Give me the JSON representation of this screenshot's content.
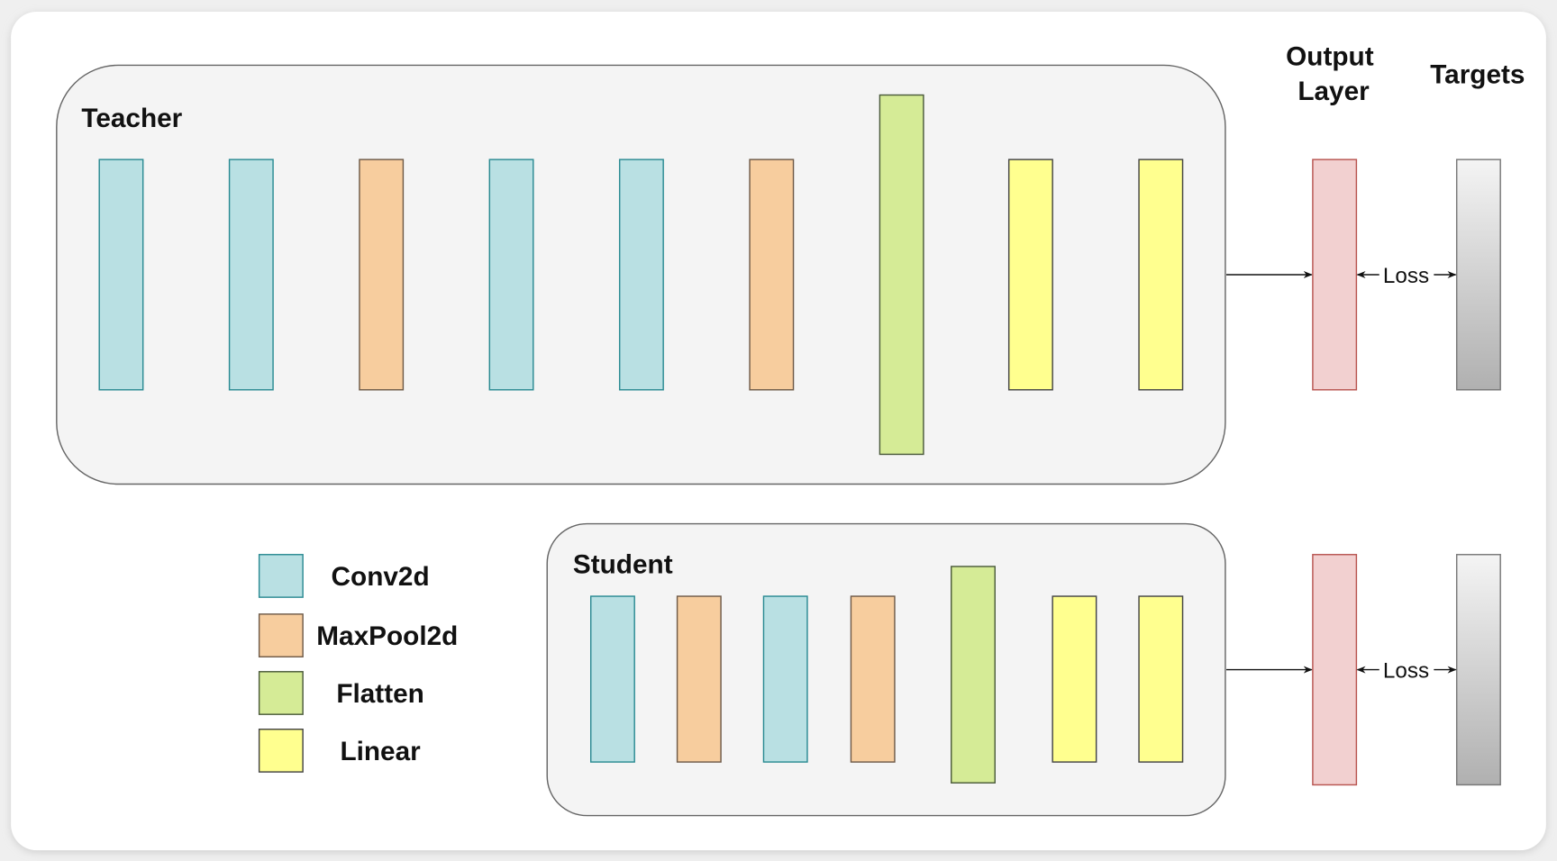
{
  "teacher": {
    "label": "Teacher",
    "layers": [
      "Conv2d",
      "Conv2d",
      "MaxPool2d",
      "Conv2d",
      "Conv2d",
      "MaxPool2d",
      "Flatten",
      "Linear",
      "Linear"
    ]
  },
  "student": {
    "label": "Student",
    "layers": [
      "Conv2d",
      "MaxPool2d",
      "Conv2d",
      "MaxPool2d",
      "Flatten",
      "Linear",
      "Linear"
    ]
  },
  "headers": {
    "output_line1": "Output",
    "output_line2": "Layer",
    "targets": "Targets"
  },
  "loss_label": "Loss",
  "legend": [
    {
      "label": "Conv2d",
      "fill": "#b9e0e3",
      "stroke": "#2a8a92"
    },
    {
      "label": "MaxPool2d",
      "fill": "#f7cd9e",
      "stroke": "#6e5a48"
    },
    {
      "label": "Flatten",
      "fill": "#d5eb96",
      "stroke": "#4a5a3a"
    },
    {
      "label": "Linear",
      "fill": "#ffff8f",
      "stroke": "#444444"
    }
  ],
  "output_layer_color": {
    "fill": "#f2d0d0",
    "stroke": "#b85450"
  },
  "targets_gradient": [
    "#f4f4f4",
    "#b0b0b0"
  ]
}
